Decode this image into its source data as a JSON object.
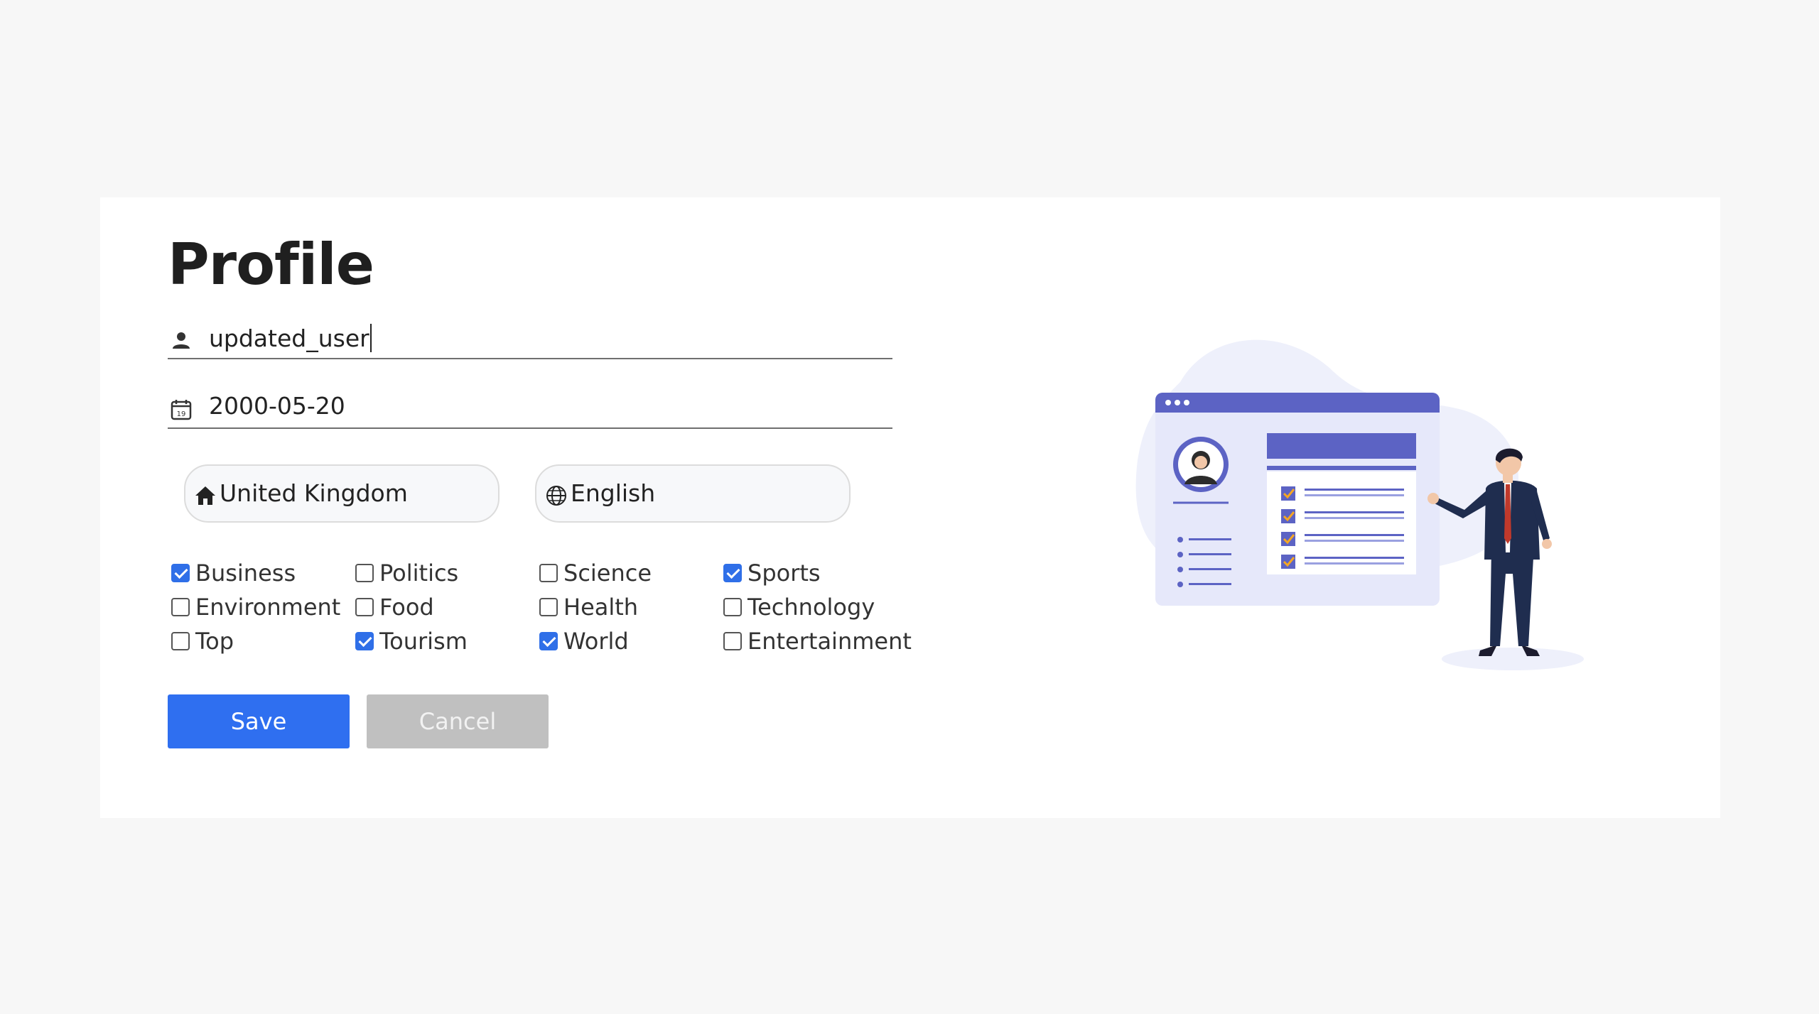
{
  "page": {
    "title": "Profile"
  },
  "form": {
    "username": {
      "value": "updated_user",
      "icon": "person-icon"
    },
    "birthdate": {
      "value": "2000-05-20",
      "icon": "calendar-icon",
      "icon_text": "19"
    },
    "country": {
      "value": "United Kingdom",
      "icon": "home-icon"
    },
    "language": {
      "value": "English",
      "icon": "globe-icon"
    }
  },
  "categories": [
    {
      "label": "Business",
      "checked": true
    },
    {
      "label": "Politics",
      "checked": false
    },
    {
      "label": "Science",
      "checked": false
    },
    {
      "label": "Sports",
      "checked": true
    },
    {
      "label": "Environment",
      "checked": false
    },
    {
      "label": "Food",
      "checked": false
    },
    {
      "label": "Health",
      "checked": false
    },
    {
      "label": "Technology",
      "checked": false
    },
    {
      "label": "Top",
      "checked": false
    },
    {
      "label": "Tourism",
      "checked": true
    },
    {
      "label": "World",
      "checked": true
    },
    {
      "label": "Entertainment",
      "checked": false
    }
  ],
  "buttons": {
    "save": "Save",
    "cancel": "Cancel"
  },
  "colors": {
    "accent": "#2f6ff0",
    "illustration": "#5c63c4",
    "cancel": "#c0c0c0"
  }
}
